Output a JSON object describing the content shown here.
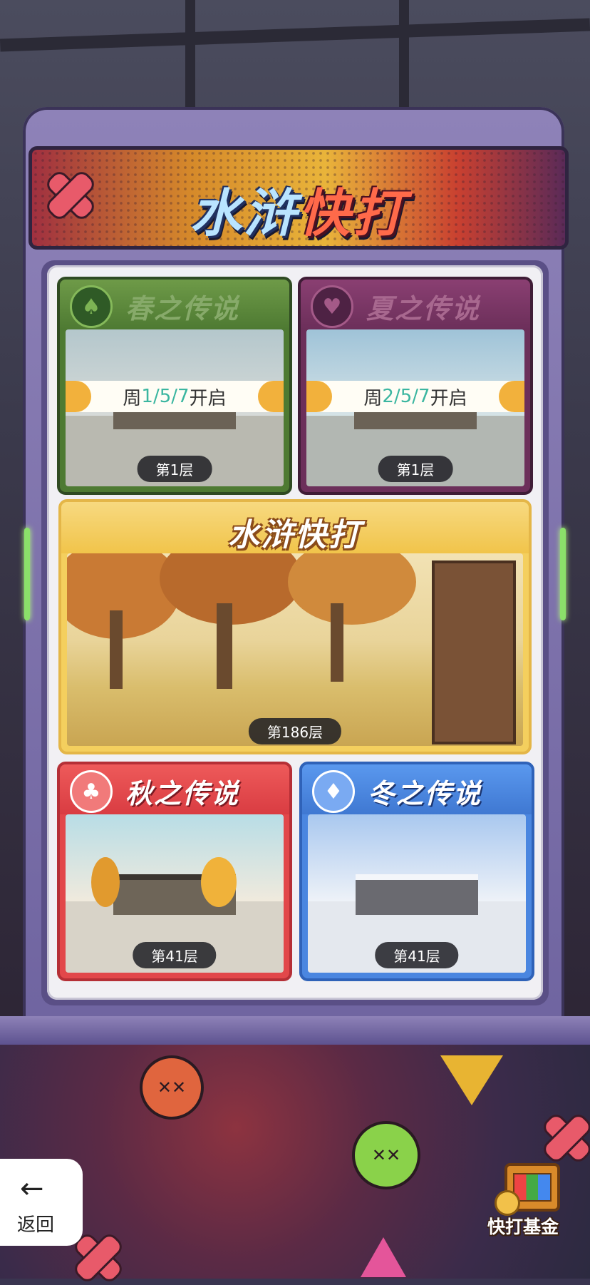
{
  "game": {
    "logo_part1": "水浒",
    "logo_part2": "快打"
  },
  "cards": {
    "spring": {
      "title": "春之传说",
      "open_prefix": "周",
      "open_days": "1/5/7",
      "open_suffix": "开启",
      "floor": "第1层",
      "icon": "spade-icon"
    },
    "summer": {
      "title": "夏之传说",
      "open_prefix": "周",
      "open_days": "2/5/7",
      "open_suffix": "开启",
      "floor": "第1层",
      "icon": "heart-icon"
    },
    "main": {
      "title": "水浒快打",
      "floor": "第186层"
    },
    "autumn": {
      "title": "秋之传说",
      "floor": "第41层",
      "icon": "club-icon"
    },
    "winter": {
      "title": "冬之传说",
      "floor": "第41层",
      "icon": "diamond-icon"
    }
  },
  "controls": {
    "back_label": "返回",
    "back_icon": "arrow-left-icon",
    "fund_label": "快打基金",
    "fund_icon": "treasure-chest-icon"
  },
  "colors": {
    "spring": "#5b8a3a",
    "summer": "#7a3a64",
    "main": "#f1c44a",
    "autumn": "#e2474a",
    "winter": "#4a86e0",
    "open_days_accent": "#3bb6a0"
  }
}
